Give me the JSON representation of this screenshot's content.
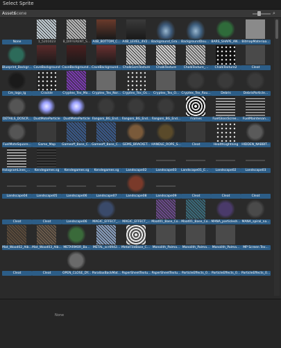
{
  "window": {
    "title": "Select Sprite"
  },
  "tabs": [
    {
      "label": "Assets",
      "active": true
    },
    {
      "label": "Scene",
      "active": false
    }
  ],
  "preview": {
    "label": "None"
  },
  "items": [
    {
      "label": "None",
      "color": "#2a2a2a",
      "fill": "none",
      "sel": true
    },
    {
      "label": "1_5201023",
      "color": "#c7d2d9",
      "fill": "speckle",
      "sel": false
    },
    {
      "label": "8_DIFFERENT_S...",
      "color": "#bcbcbc",
      "fill": "speckle",
      "sel": false
    },
    {
      "label": "A4B_BOTTOM_C...",
      "color": "#6a3a2b",
      "fill": "dark",
      "sel": true
    },
    {
      "label": "A4B_LEVEL_4V2...",
      "color": "#3a3a3a",
      "fill": "dark",
      "sel": true
    },
    {
      "label": "Background_Grad...",
      "color": "#3d5a7a",
      "fill": "cloud",
      "sel": true
    },
    {
      "label": "BackgroundDoubl...",
      "color": "#3f6080",
      "fill": "cloud",
      "sel": true
    },
    {
      "label": "BARS_SHAPE_AN...",
      "color": "#2f6b3a",
      "fill": "sprite",
      "sel": true
    },
    {
      "label": "BitmapMateriaa...",
      "color": "#8a8a8a",
      "fill": "plain",
      "sel": true
    },
    {
      "label": "Blueprint_Background...",
      "color": "#2d6b5a",
      "fill": "sprite",
      "sel": true
    },
    {
      "label": "CaveBackground",
      "color": "#5a2a2a",
      "fill": "dark",
      "sel": true
    },
    {
      "label": "CaveBackground...",
      "color": "#4a1f1f",
      "fill": "dark",
      "sel": true
    },
    {
      "label": "CaveBackgroundFa...",
      "color": "#6a3030",
      "fill": "dark",
      "sel": true
    },
    {
      "label": "ChalkGsmTexture",
      "color": "#c8c8c8",
      "fill": "speckle",
      "sel": true
    },
    {
      "label": "ChalkTexture",
      "color": "#d0d0d0",
      "fill": "speckle",
      "sel": true
    },
    {
      "label": "ChalkTexture_...",
      "color": "#bfbfbf",
      "fill": "speckle",
      "sel": true
    },
    {
      "label": "ChalkTexture2",
      "color": "#111111",
      "fill": "dots",
      "sel": true
    },
    {
      "label": "Cleat",
      "color": "#4a4a4a",
      "fill": "plain",
      "sel": true
    },
    {
      "label": "Cm_logo_lg",
      "color": "#1a1a1a",
      "fill": "sprite",
      "sel": true
    },
    {
      "label": "Crackle",
      "color": "#202020",
      "fill": "dots",
      "sel": true
    },
    {
      "label": "Cryptex_Tex_Ma...",
      "color": "#7a3ab0",
      "fill": "speckle",
      "sel": true
    },
    {
      "label": "Cryptex_Tex_Nor...",
      "color": "#6a6a6a",
      "fill": "plain",
      "sel": true
    },
    {
      "label": "Cryptex_Tex_Oc...",
      "color": "#2a2a2a",
      "fill": "dots",
      "sel": true
    },
    {
      "label": "Cryptex_Tex_O...",
      "color": "#5a5a5a",
      "fill": "plain",
      "sel": true
    },
    {
      "label": "Cryptex_Tex_Rou...",
      "color": "#3a3a3a",
      "fill": "sprite",
      "sel": true
    },
    {
      "label": "Debris",
      "color": "#3a3a3a",
      "fill": "sprite",
      "sel": true
    },
    {
      "label": "DebrisParticle...",
      "color": "#3a3a3a",
      "fill": "sprite",
      "sel": true
    },
    {
      "label": "DETAILS_DOSCR...",
      "color": "#555555",
      "fill": "sprite",
      "sel": true
    },
    {
      "label": "DustMoteParticle",
      "color": "#e8e8ff",
      "fill": "glow",
      "sel": true
    },
    {
      "label": "DustMoteParticle",
      "color": "#e8e8ff",
      "fill": "glow",
      "sel": true
    },
    {
      "label": "Fangoni_BG_End...",
      "color": "#3a3a3a",
      "fill": "sprite",
      "sel": true
    },
    {
      "label": "Fangoni_BG_End...",
      "color": "#3a3a3a",
      "fill": "sprite",
      "sel": true
    },
    {
      "label": "Fangoni_BG_End...",
      "color": "#3a3a3a",
      "fill": "sprite",
      "sel": true
    },
    {
      "label": "Frames",
      "color": "#111111",
      "fill": "rings",
      "sel": true
    },
    {
      "label": "FuelGlossScree...",
      "color": "#9a9a9a",
      "fill": "stripes",
      "sel": true
    },
    {
      "label": "FuelMaintenan...",
      "color": "#8a8a8a",
      "fill": "stripes",
      "sel": true
    },
    {
      "label": "FuelMoteSquare...",
      "color": "#555555",
      "fill": "sprite",
      "sel": true
    },
    {
      "label": "Game_Map",
      "color": "#3a3a3a",
      "fill": "plain",
      "sel": true
    },
    {
      "label": "Gameoff_Base_Co...",
      "color": "#3a5a8a",
      "fill": "speckle",
      "sel": true
    },
    {
      "label": "Gameoff_Base_Co...",
      "color": "#3a5a8a",
      "fill": "speckle",
      "sel": true
    },
    {
      "label": "GEMS_BRACKET...",
      "color": "#7a5a3a",
      "fill": "sprite",
      "sel": true
    },
    {
      "label": "HANDLE_ROPE_S...",
      "color": "#5a4a2a",
      "fill": "sprite",
      "sel": true
    },
    {
      "label": "Cleat",
      "color": "#3a3a3a",
      "fill": "plain",
      "sel": true
    },
    {
      "label": "HealthLightning",
      "color": "#2a2a2a",
      "fill": "dots",
      "sel": true
    },
    {
      "label": "HIDDEN_NABBIT...",
      "color": "#5a5a5a",
      "fill": "sprite",
      "sel": true
    },
    {
      "label": "HologramLines_C...",
      "color": "#9a9a9a",
      "fill": "stripes",
      "sel": true
    },
    {
      "label": "Kendegames.sg",
      "color": "#3a3a3a",
      "fill": "stripes",
      "sel": true
    },
    {
      "label": "Kendegames.sg",
      "color": "#2a2a2a",
      "fill": "plain",
      "sel": true
    },
    {
      "label": "Kendegames.sg",
      "color": "#2a2a2a",
      "fill": "plain",
      "sel": true
    },
    {
      "label": "Landscape02",
      "color": "#2a2a2a",
      "fill": "plain",
      "sel": true
    },
    {
      "label": "Landscape03",
      "color": "#2a2a2a",
      "fill": "line",
      "sel": true
    },
    {
      "label": "Landscape01_Em...",
      "color": "#2a2a2a",
      "fill": "line",
      "sel": true
    },
    {
      "label": "Landscape02",
      "color": "#2a2a2a",
      "fill": "line",
      "sel": true
    },
    {
      "label": "Landscape03",
      "color": "#2a2a2a",
      "fill": "line",
      "sel": true
    },
    {
      "label": "Landscape04",
      "color": "#2a2a2a",
      "fill": "line",
      "sel": true
    },
    {
      "label": "Landscape05",
      "color": "#2a2a2a",
      "fill": "line",
      "sel": true
    },
    {
      "label": "Landscape06",
      "color": "#2a2a2a",
      "fill": "line",
      "sel": true
    },
    {
      "label": "Landscape07",
      "color": "#2a2a2a",
      "fill": "line",
      "sel": true
    },
    {
      "label": "Landscape08",
      "color": "#7a3a2a",
      "fill": "sprite",
      "sel": true
    },
    {
      "label": "Landscape09",
      "color": "#2a2a2a",
      "fill": "line",
      "sel": true
    },
    {
      "label": "Cleat",
      "color": "#2a2a2a",
      "fill": "plain",
      "sel": true
    },
    {
      "label": "Cleat",
      "color": "#2a2a2a",
      "fill": "plain",
      "sel": true
    },
    {
      "label": "Cleat",
      "color": "#2a2a2a",
      "fill": "plain",
      "sel": true
    },
    {
      "label": "Cleat",
      "color": "#2a2a2a",
      "fill": "plain",
      "sel": true
    },
    {
      "label": "Cleat",
      "color": "#2a2a2a",
      "fill": "plain",
      "sel": true
    },
    {
      "label": "Landscape06",
      "color": "#2a2a2a",
      "fill": "plain",
      "sel": true
    },
    {
      "label": "MAGIC_EFFECT_...",
      "color": "#3a4a6a",
      "fill": "sprite",
      "sel": true
    },
    {
      "label": "MAGIC_EFFECT_...",
      "color": "#2a2a2a",
      "fill": "sprite",
      "sel": true
    },
    {
      "label": "Maat01_Base_Co...",
      "color": "#6a4a8a",
      "fill": "speckle",
      "sel": true
    },
    {
      "label": "Maat01_Base_Co...",
      "color": "#3a6a7a",
      "fill": "speckle",
      "sel": true
    },
    {
      "label": "MANA_particlesh...",
      "color": "#4a3a6a",
      "fill": "sprite",
      "sel": true
    },
    {
      "label": "MANA_spiral_na...",
      "color": "#4a4a4a",
      "fill": "sprite",
      "sel": true
    },
    {
      "label": "Mat_Wood02_Alb...",
      "color": "#5a4a3a",
      "fill": "speckle",
      "sel": true
    },
    {
      "label": "Mat_Wood03_Alb...",
      "color": "#6a5a4a",
      "fill": "speckle",
      "sel": true
    },
    {
      "label": "METARMOR_Ba...",
      "color": "#3a6a3a",
      "fill": "sprite",
      "sel": true
    },
    {
      "label": "METAL_scr0942...",
      "color": "#8aa0c0",
      "fill": "speckle",
      "sel": true
    },
    {
      "label": "MetalTileBase_Co...",
      "color": "#4a4a4a",
      "fill": "rings",
      "sel": true
    },
    {
      "label": "Monolith_Palma...",
      "color": "#4a4a4a",
      "fill": "plain",
      "sel": true
    },
    {
      "label": "Monolith_Palma...",
      "color": "#4a4a4a",
      "fill": "plain",
      "sel": true
    },
    {
      "label": "Monolith_Palma...",
      "color": "#4a4a4a",
      "fill": "plain",
      "sel": true
    },
    {
      "label": "MP Screen Tex...",
      "color": "#2a2a2a",
      "fill": "plain",
      "sel": true
    },
    {
      "label": "Cleat",
      "color": "#2a2a2a",
      "fill": "plain",
      "sel": true
    },
    {
      "label": "Cleat",
      "color": "#2a2a2a",
      "fill": "plain",
      "sel": true
    },
    {
      "label": "OPEN_CLOSE_DY...",
      "color": "#6a6a6a",
      "fill": "sprite",
      "sel": true
    },
    {
      "label": "ParallaxBackMat...",
      "color": "#2a2a2a",
      "fill": "plain",
      "sel": true
    },
    {
      "label": "PaperSheetTextu...",
      "color": "#2a2a2a",
      "fill": "plain",
      "sel": true
    },
    {
      "label": "PaperSheetTextu...",
      "color": "#2a2a2a",
      "fill": "plain",
      "sel": true
    },
    {
      "label": "ParticleEffects_0...",
      "color": "#2a2a2a",
      "fill": "plain",
      "sel": true
    },
    {
      "label": "ParticleEffects_0...",
      "color": "#2a2a2a",
      "fill": "plain",
      "sel": true
    },
    {
      "label": "ParticleEffects_0...",
      "color": "#2a2a2a",
      "fill": "plain",
      "sel": true
    }
  ]
}
